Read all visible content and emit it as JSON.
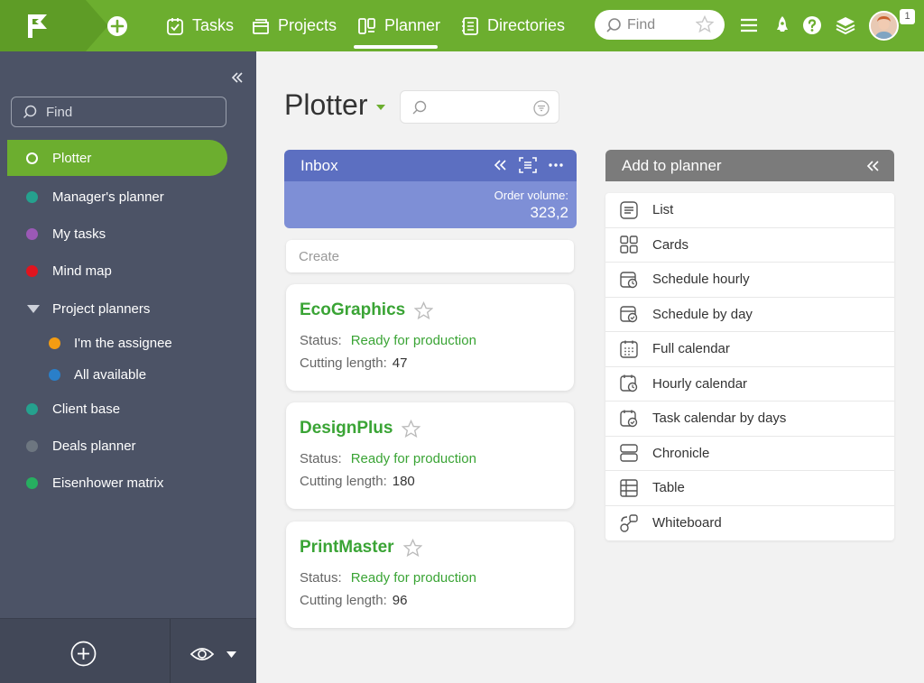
{
  "topbar": {
    "nav": [
      {
        "label": "Tasks",
        "icon": "tasks-icon"
      },
      {
        "label": "Projects",
        "icon": "projects-icon"
      },
      {
        "label": "Planner",
        "icon": "planner-icon",
        "active": true
      },
      {
        "label": "Directories",
        "icon": "directories-icon"
      }
    ],
    "find_placeholder": "Find",
    "notification_count": "1",
    "accent_color": "#6cae2f"
  },
  "sidebar": {
    "find_placeholder": "Find",
    "items": [
      {
        "label": "Plotter",
        "color": "#ffffff",
        "active": true
      },
      {
        "label": "Manager's planner",
        "color": "#25a18e"
      },
      {
        "label": "My tasks",
        "color": "#9b59b6"
      },
      {
        "label": "Mind map",
        "color": "#e0141e"
      },
      {
        "label": "Project planners",
        "group": true
      },
      {
        "label": "I'm the assignee",
        "color": "#f39c12"
      },
      {
        "label": "All available",
        "color": "#2a7fc9"
      },
      {
        "label": "Client base",
        "color": "#25a18e"
      },
      {
        "label": "Deals planner",
        "color": "#6d7680"
      },
      {
        "label": "Eisenhower matrix",
        "color": "#27ae60"
      }
    ]
  },
  "main": {
    "title": "Plotter",
    "inbox": {
      "title": "Inbox",
      "metric_label": "Order volume:",
      "metric_value": "323,2",
      "create_placeholder": "Create",
      "cards": [
        {
          "name": "EcoGraphics",
          "status_label": "Status:",
          "status": "Ready for production",
          "length_label": "Cutting length:",
          "length": "47"
        },
        {
          "name": "DesignPlus",
          "status_label": "Status:",
          "status": "Ready for production",
          "length_label": "Cutting length:",
          "length": "180"
        },
        {
          "name": "PrintMaster",
          "status_label": "Status:",
          "status": "Ready for production",
          "length_label": "Cutting length:",
          "length": "96"
        }
      ]
    },
    "add_panel": {
      "title": "Add to planner",
      "items": [
        {
          "label": "List",
          "icon": "list-icon"
        },
        {
          "label": "Cards",
          "icon": "cards-icon"
        },
        {
          "label": "Schedule hourly",
          "icon": "schedule-hourly-icon"
        },
        {
          "label": "Schedule by day",
          "icon": "schedule-by-day-icon"
        },
        {
          "label": "Full calendar",
          "icon": "full-calendar-icon"
        },
        {
          "label": "Hourly calendar",
          "icon": "hourly-calendar-icon"
        },
        {
          "label": "Task calendar by days",
          "icon": "task-calendar-icon"
        },
        {
          "label": "Chronicle",
          "icon": "chronicle-icon"
        },
        {
          "label": "Table",
          "icon": "table-icon"
        },
        {
          "label": "Whiteboard",
          "icon": "whiteboard-icon"
        }
      ]
    }
  }
}
